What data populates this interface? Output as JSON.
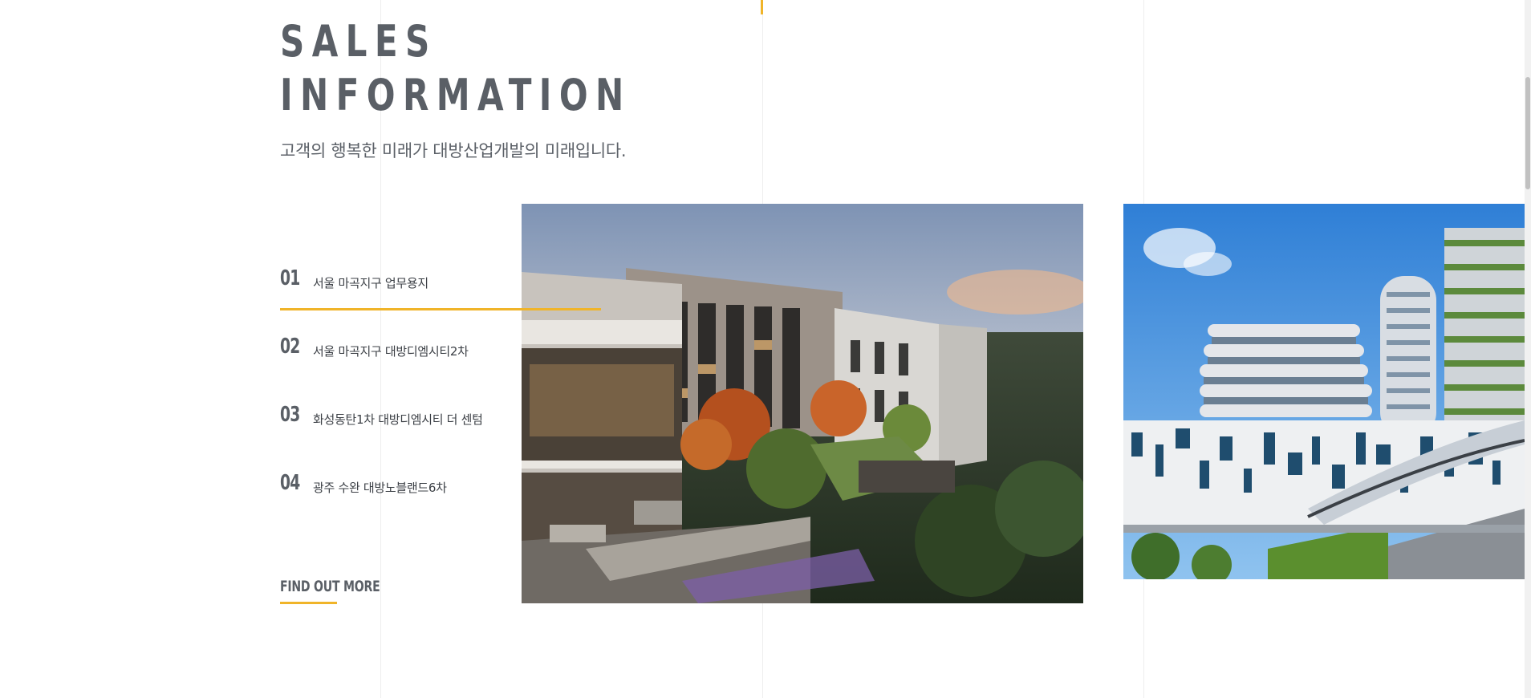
{
  "header": {
    "title_line1": "SALES",
    "title_line2": "INFORMATION",
    "subtitle": "고객의 행복한 미래가 대방산업개발의 미래입니다."
  },
  "sales_list": [
    {
      "number": "01",
      "label": "서울 마곡지구 업무용지",
      "active": true
    },
    {
      "number": "02",
      "label": "서울 마곡지구 대방디엠시티2차",
      "active": false
    },
    {
      "number": "03",
      "label": "화성동탄1차 대방디엠시티 더 센텀",
      "active": false
    },
    {
      "number": "04",
      "label": "광주 수완 대방노블랜드6차",
      "active": false
    }
  ],
  "cta": {
    "label": "FIND OUT MORE"
  },
  "images": {
    "main": "apartment-complex-courtyard-rendering",
    "side": "curved-high-rise-towers-with-walkway"
  },
  "colors": {
    "accent": "#f0b429",
    "heading": "#5a5f66",
    "text": "#3b3f45"
  }
}
